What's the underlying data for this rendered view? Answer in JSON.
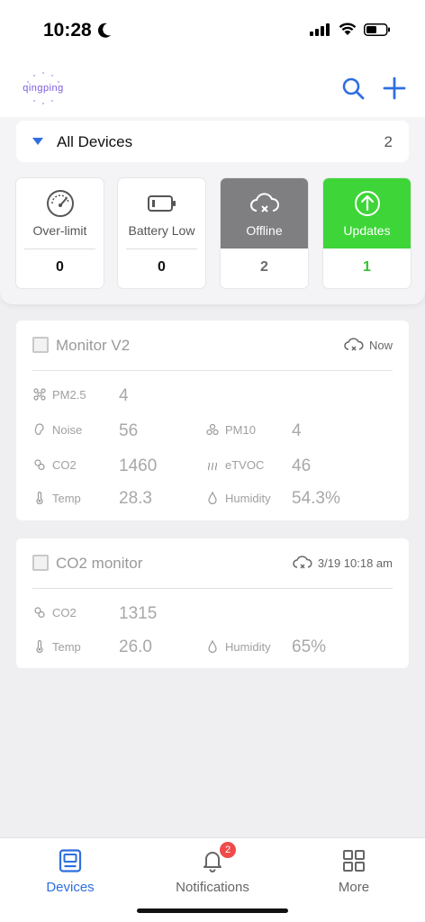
{
  "status": {
    "time": "10:28"
  },
  "app": {
    "logo_text": "qingping"
  },
  "devices_bar": {
    "label": "All Devices",
    "count": "2"
  },
  "stats": [
    {
      "label": "Over-limit",
      "count": "0",
      "icon": "gauge-icon"
    },
    {
      "label": "Battery Low",
      "count": "0",
      "icon": "battery-icon"
    },
    {
      "label": "Offline",
      "count": "2",
      "icon": "cloud-offline-icon"
    },
    {
      "label": "Updates",
      "count": "1",
      "icon": "upload-circle-icon"
    }
  ],
  "devices": [
    {
      "name": "Monitor V2",
      "status": "Now",
      "metrics": [
        {
          "label": "PM2.5",
          "value": "4"
        },
        {
          "label": "Noise",
          "value": "56"
        },
        {
          "label": "PM10",
          "value": "4"
        },
        {
          "label": "CO2",
          "value": "1460"
        },
        {
          "label": "eTVOC",
          "value": "46"
        },
        {
          "label": "Temp",
          "value": "28.3"
        },
        {
          "label": "Humidity",
          "value": "54.3%"
        }
      ]
    },
    {
      "name": "CO2 monitor",
      "status": "3/19 10:18 am",
      "metrics": [
        {
          "label": "CO2",
          "value": "1315"
        },
        {
          "label": "Temp",
          "value": "26.0"
        },
        {
          "label": "Humidity",
          "value": "65%"
        }
      ]
    }
  ],
  "tabs": [
    {
      "label": "Devices"
    },
    {
      "label": "Notifications",
      "badge": "2"
    },
    {
      "label": "More"
    }
  ],
  "colors": {
    "accent": "#2f6ee0",
    "offline": "#7f7f81",
    "updates": "#3ed538",
    "badge": "#ef4b4b"
  }
}
